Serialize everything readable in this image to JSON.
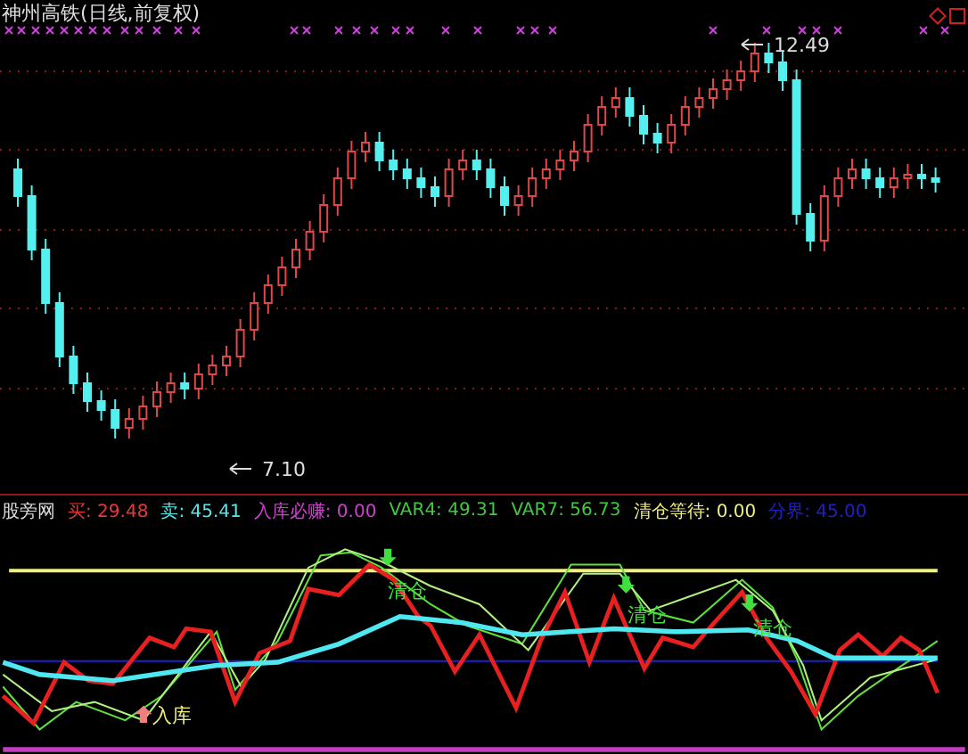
{
  "chart_title": "神州高铁(日线,前复权)",
  "price_labels": [
    {
      "text": "12.49",
      "kind": "high"
    },
    {
      "text": "7.10",
      "kind": "low"
    }
  ],
  "indicator": {
    "name": "股旁网",
    "readings": [
      {
        "label": "买:",
        "value": "29.48",
        "color": "#e83a3a"
      },
      {
        "label": "卖:",
        "value": "45.41",
        "color": "#55e8e8"
      },
      {
        "label": "入库必赚:",
        "value": "0.00",
        "color": "#d040d0"
      },
      {
        "label": "VAR4:",
        "value": "49.31",
        "color": "#40c840"
      },
      {
        "label": "VAR7:",
        "value": "56.73",
        "color": "#40c840"
      },
      {
        "label": "清仓等待:",
        "value": "0.00",
        "color": "#f0f080"
      },
      {
        "label": "分界:",
        "value": "45.00",
        "color": "#2020c8"
      }
    ]
  },
  "signals": [
    {
      "text": "入库",
      "kind": "buy"
    },
    {
      "text": "清仓",
      "kind": "sell"
    },
    {
      "text": "清仓",
      "kind": "sell"
    },
    {
      "text": "清仓",
      "kind": "sell"
    }
  ]
}
